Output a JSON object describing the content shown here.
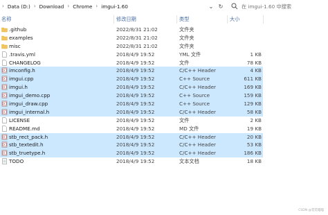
{
  "breadcrumb": {
    "items": [
      "Data (D:)",
      "Download",
      "Chrome",
      "imgui-1.60"
    ]
  },
  "search": {
    "placeholder": "在 imgui-1.60 中搜索"
  },
  "columns": {
    "name": "名称",
    "date": "修改日期",
    "type": "类型",
    "size": "大小"
  },
  "files": [
    {
      "name": ".github",
      "date": "2022/8/31 21:02",
      "type": "文件夹",
      "size": "",
      "icon": "folder",
      "selected": false
    },
    {
      "name": "examples",
      "date": "2022/8/31 21:02",
      "type": "文件夹",
      "size": "",
      "icon": "folder",
      "selected": false
    },
    {
      "name": "misc",
      "date": "2022/8/31 21:02",
      "type": "文件夹",
      "size": "",
      "icon": "folder",
      "selected": false
    },
    {
      "name": ".travis.yml",
      "date": "2018/4/9 19:52",
      "type": "YML 文件",
      "size": "1 KB",
      "icon": "file",
      "selected": false
    },
    {
      "name": "CHANGELOG",
      "date": "2018/4/9 19:52",
      "type": "文件",
      "size": "78 KB",
      "icon": "file",
      "selected": false
    },
    {
      "name": "imconfig.h",
      "date": "2018/4/9 19:52",
      "type": "C/C++ Header",
      "size": "4 KB",
      "icon": "code",
      "selected": true
    },
    {
      "name": "imgui.cpp",
      "date": "2018/4/9 19:52",
      "type": "C++ Source",
      "size": "611 KB",
      "icon": "code",
      "selected": true
    },
    {
      "name": "imgui.h",
      "date": "2018/4/9 19:52",
      "type": "C/C++ Header",
      "size": "169 KB",
      "icon": "code",
      "selected": true
    },
    {
      "name": "imgui_demo.cpp",
      "date": "2018/4/9 19:52",
      "type": "C++ Source",
      "size": "159 KB",
      "icon": "code",
      "selected": true
    },
    {
      "name": "imgui_draw.cpp",
      "date": "2018/4/9 19:52",
      "type": "C++ Source",
      "size": "129 KB",
      "icon": "code",
      "selected": true
    },
    {
      "name": "imgui_internal.h",
      "date": "2018/4/9 19:52",
      "type": "C/C++ Header",
      "size": "58 KB",
      "icon": "code",
      "selected": true
    },
    {
      "name": "LICENSE",
      "date": "2018/4/9 19:52",
      "type": "文件",
      "size": "2 KB",
      "icon": "file",
      "selected": false
    },
    {
      "name": "README.md",
      "date": "2018/4/9 19:52",
      "type": "MD 文件",
      "size": "19 KB",
      "icon": "file",
      "selected": false
    },
    {
      "name": "stb_rect_pack.h",
      "date": "2018/4/9 19:52",
      "type": "C/C++ Header",
      "size": "20 KB",
      "icon": "code",
      "selected": true
    },
    {
      "name": "stb_textedit.h",
      "date": "2018/4/9 19:52",
      "type": "C/C++ Header",
      "size": "53 KB",
      "icon": "code",
      "selected": true
    },
    {
      "name": "stb_truetype.h",
      "date": "2018/4/9 19:52",
      "type": "C/C++ Header",
      "size": "186 KB",
      "icon": "code",
      "selected": true
    },
    {
      "name": "TODO",
      "date": "2018/4/9 19:52",
      "type": "文本文档",
      "size": "18 KB",
      "icon": "text",
      "selected": false
    }
  ],
  "watermark": "CSDN @花花喵喵",
  "colors": {
    "selection": "#cce8ff",
    "folder": "#f2c55c",
    "header_text": "#4a6fa5"
  }
}
